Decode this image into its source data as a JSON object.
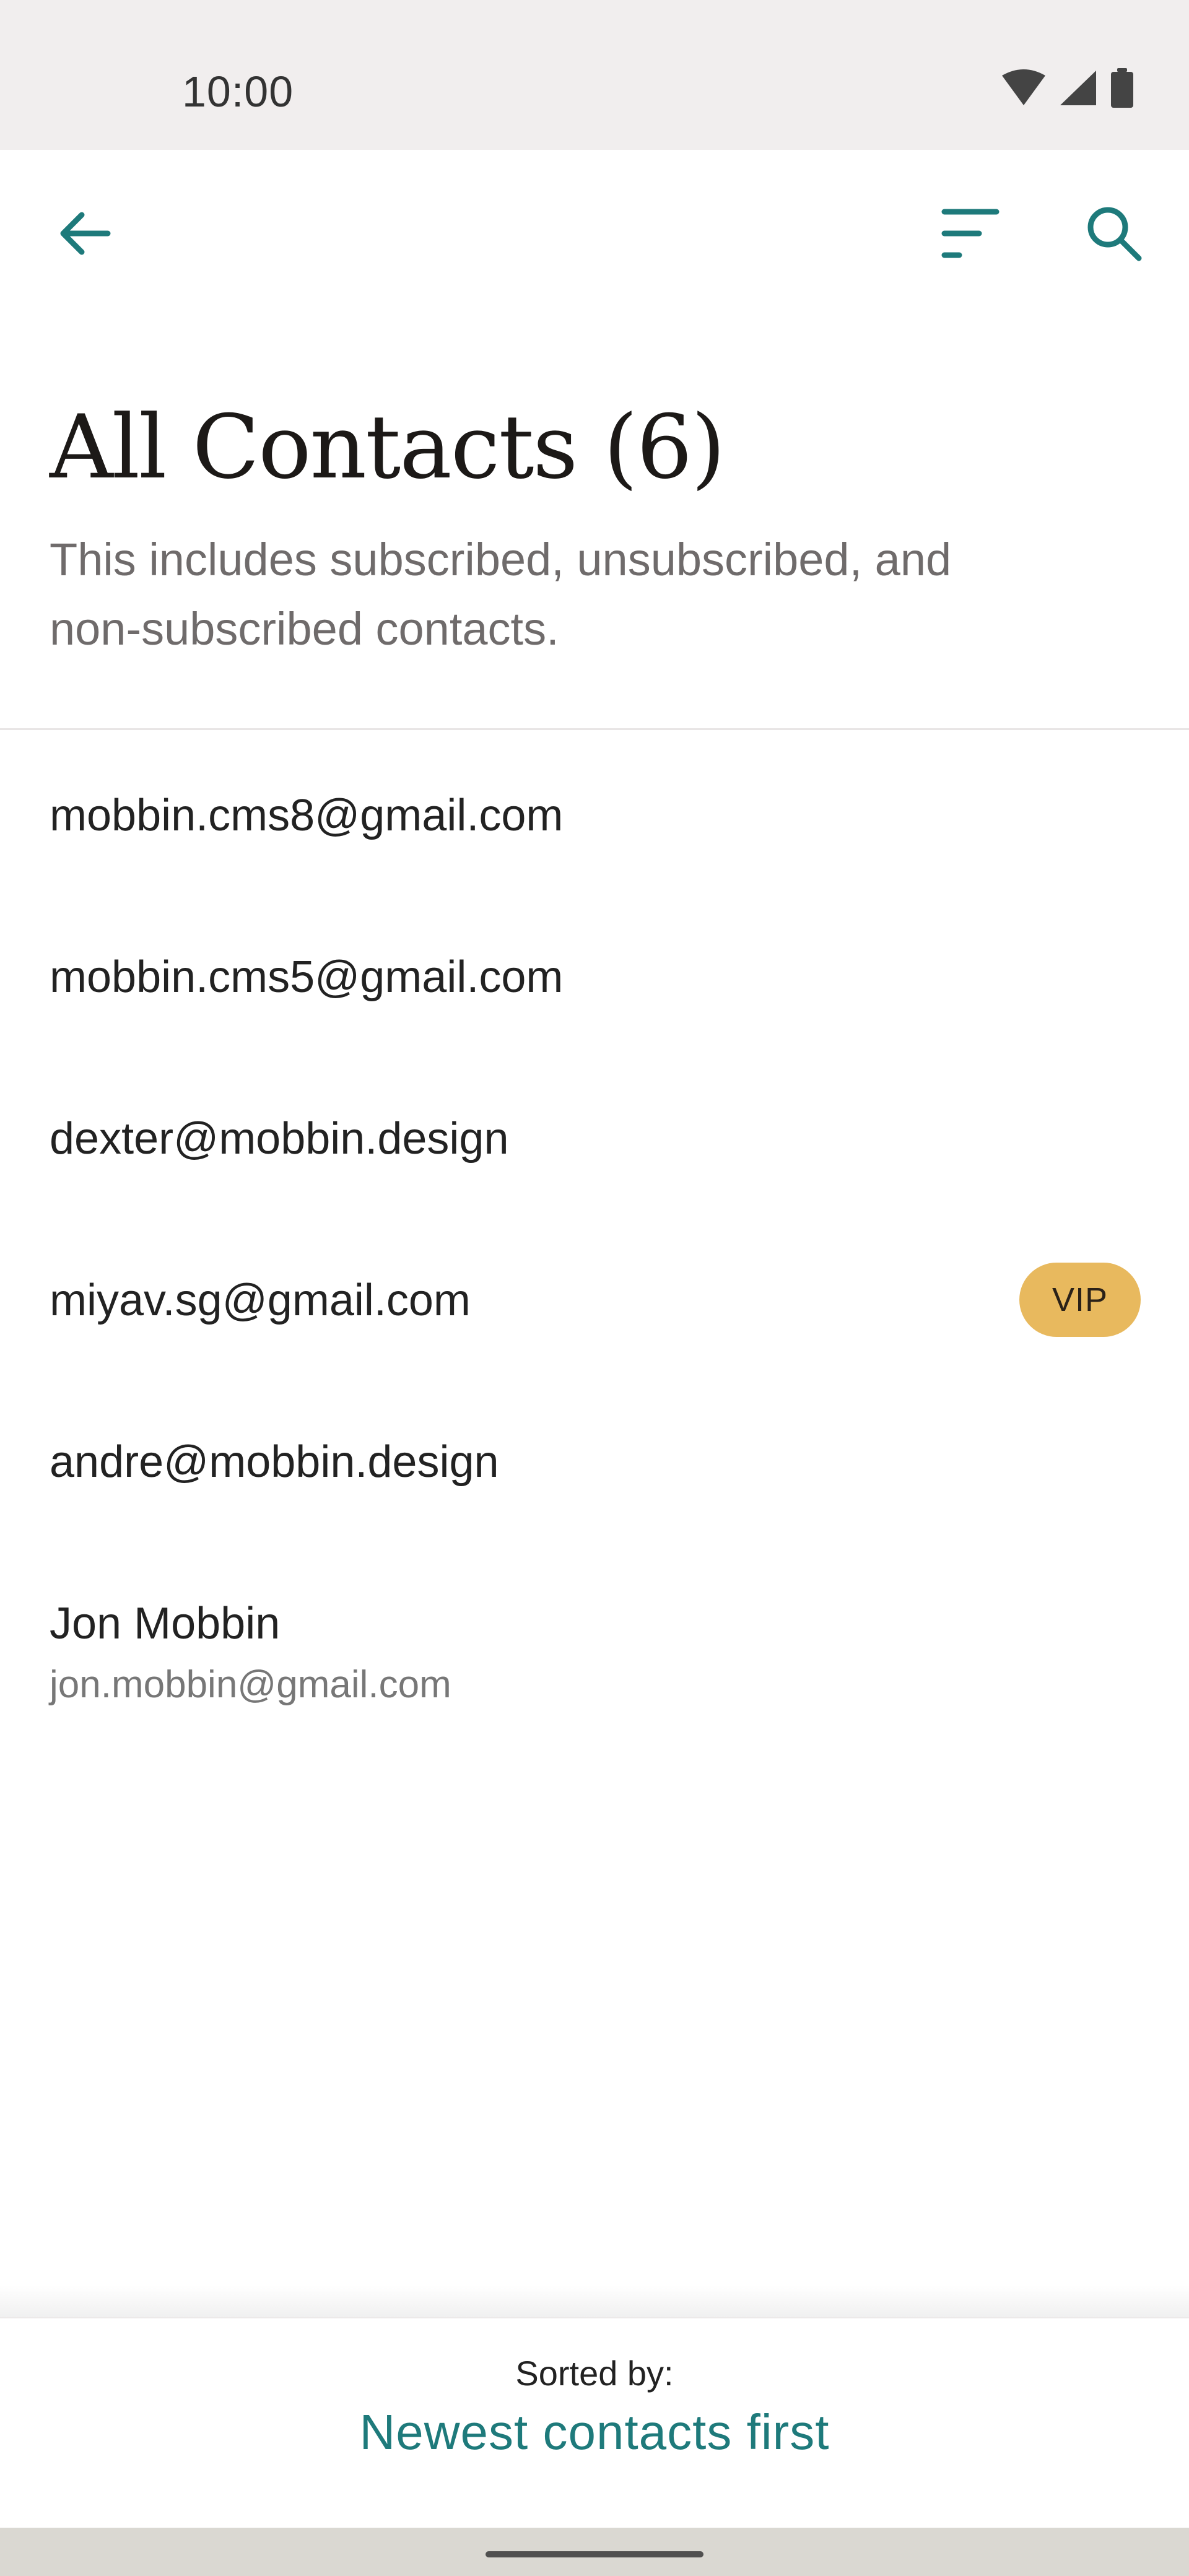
{
  "status_bar": {
    "time": "10:00",
    "icons": [
      "wifi-icon",
      "cell-signal-icon",
      "battery-icon"
    ]
  },
  "app_bar": {
    "back_icon": "arrow-left-icon",
    "sort_icon": "sort-lines-icon",
    "search_icon": "search-icon",
    "accent_color": "#1e7a7b"
  },
  "header": {
    "title": "All Contacts (6)",
    "subtitle": "This includes subscribed, unsubscribed, and non-subscribed contacts."
  },
  "contacts": [
    {
      "primary": "mobbin.cms8@gmail.com"
    },
    {
      "primary": "mobbin.cms5@gmail.com"
    },
    {
      "primary": "dexter@mobbin.design"
    },
    {
      "primary": "miyav.sg@gmail.com",
      "badge": "VIP"
    },
    {
      "primary": "andre@mobbin.design"
    },
    {
      "primary": "Jon Mobbin",
      "secondary": "jon.mobbin@gmail.com"
    }
  ],
  "sort_panel": {
    "caption": "Sorted by:",
    "value": "Newest contacts first"
  },
  "colors": {
    "vip_badge": "#e8b95e",
    "status_bar_bg": "#f1eeee"
  }
}
